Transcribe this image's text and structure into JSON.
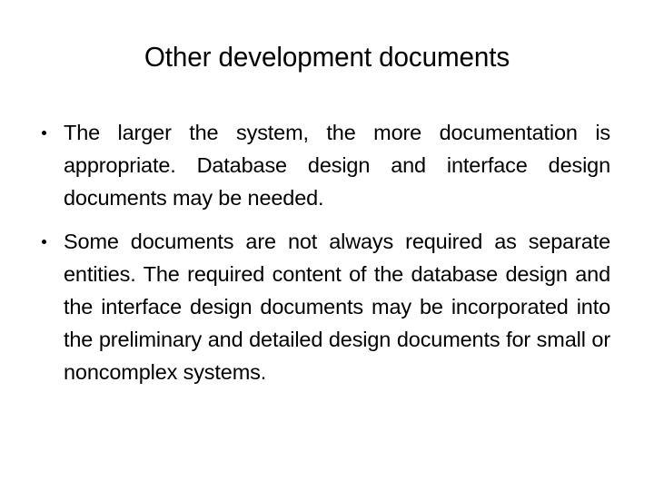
{
  "slide": {
    "background_color": "#ffffff",
    "text_color": "#000000",
    "title": "Other development documents",
    "bullets": [
      {
        "marker": "bullet-dot",
        "text": "The larger the system, the more documentation is appropriate. Database design and interface design documents may be needed."
      },
      {
        "marker": "bullet-dot",
        "text": "Some documents are not always required as separate entities. The required content of the database design and the interface design documents may be incorporated into the preliminary and detailed design documents for small or noncomplex systems."
      }
    ]
  }
}
